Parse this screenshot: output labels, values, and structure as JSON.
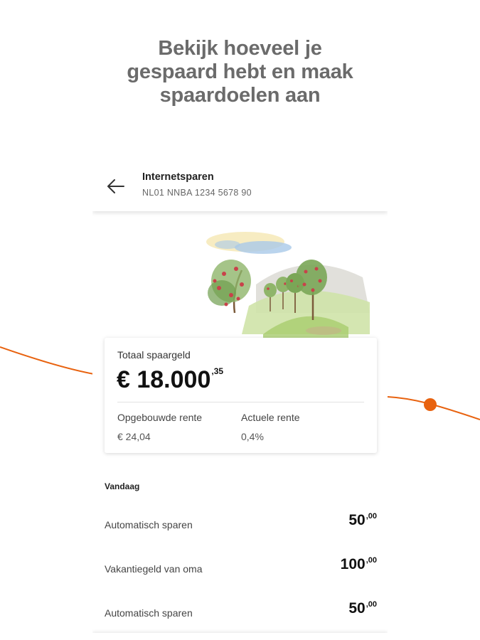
{
  "promo": {
    "headline_line1": "Bekijk hoeveel je",
    "headline_line2": "gespaard hebt en maak",
    "headline_line3": "spaardoelen aan"
  },
  "colors": {
    "accent_orange": "#e8620f",
    "headline_gray": "#6b6b6b"
  },
  "appbar": {
    "back_icon": "arrow-left-icon",
    "title": "Internetsparen",
    "account_number": "NL01 NNBA 1234 5678 90"
  },
  "illustration": {
    "icon": "apple-orchard-watercolor"
  },
  "balance_card": {
    "label": "Totaal spaargeld",
    "amount_main": "€ 18.000",
    "amount_cents": ",35",
    "accrued_interest_label": "Opgebouwde rente",
    "accrued_interest_value": "€ 24,04",
    "current_rate_label": "Actuele rente",
    "current_rate_value": "0,4%"
  },
  "transactions": {
    "section_title": "Vandaag",
    "items": [
      {
        "description": "Automatisch sparen",
        "amount_main": "50",
        "amount_cents": ",00"
      },
      {
        "description": "Vakantiegeld van oma",
        "amount_main": "100",
        "amount_cents": ",00"
      },
      {
        "description": "Automatisch sparen",
        "amount_main": "50",
        "amount_cents": ",00"
      }
    ]
  }
}
